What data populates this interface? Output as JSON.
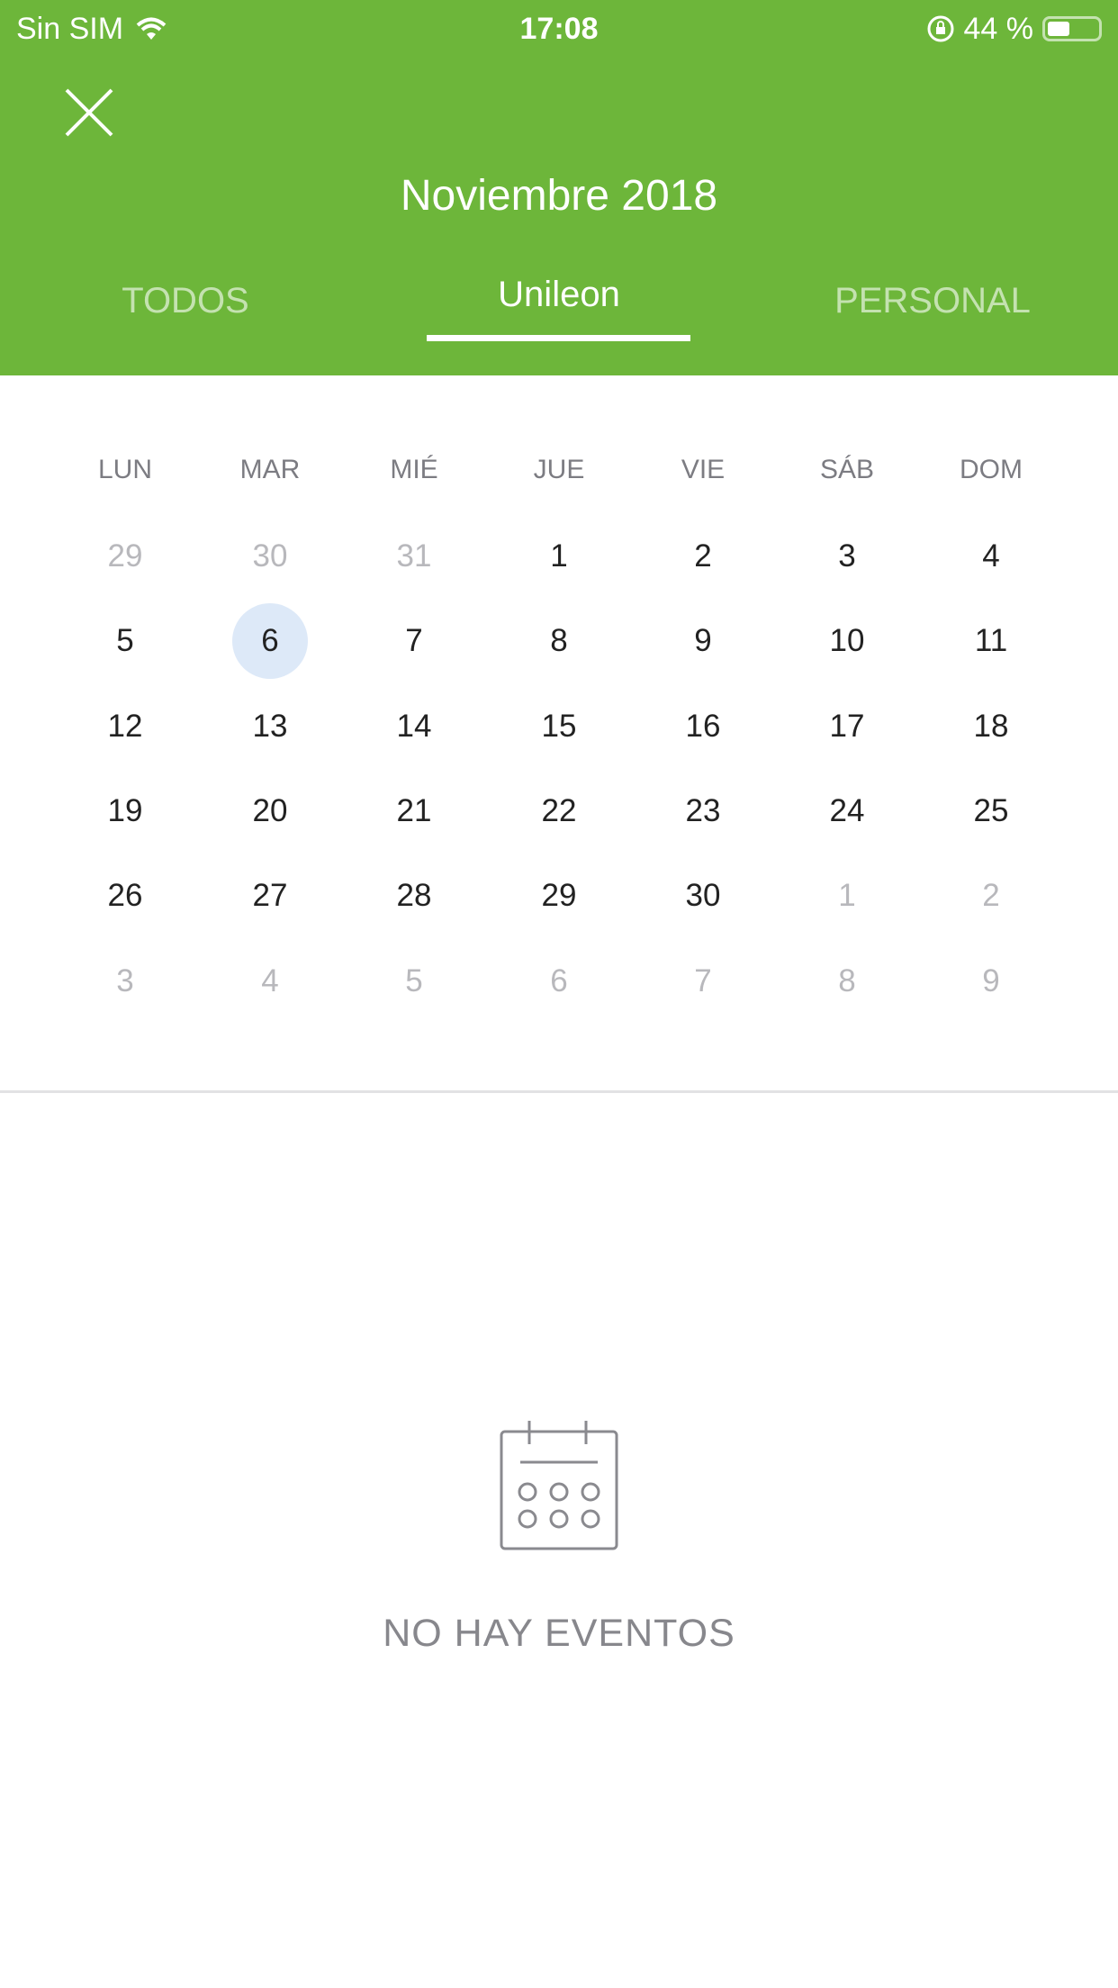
{
  "status_bar": {
    "carrier": "Sin SIM",
    "time": "17:08",
    "battery": "44 %",
    "battery_level": 0.44
  },
  "header": {
    "title": "Noviembre 2018",
    "close_icon": "close-icon",
    "tabs": [
      {
        "label": "TODOS",
        "active": false
      },
      {
        "label": "Unileon",
        "active": true
      },
      {
        "label": "PERSONAL",
        "active": false
      }
    ]
  },
  "colors": {
    "brand": "#6db63a",
    "selected_day": "#dde9f8"
  },
  "calendar": {
    "weekdays": [
      "LUN",
      "MAR",
      "MIÉ",
      "JUE",
      "VIE",
      "SÁB",
      "DOM"
    ],
    "weeks": [
      [
        {
          "d": "29",
          "out": true
        },
        {
          "d": "30",
          "out": true
        },
        {
          "d": "31",
          "out": true
        },
        {
          "d": "1"
        },
        {
          "d": "2"
        },
        {
          "d": "3"
        },
        {
          "d": "4"
        }
      ],
      [
        {
          "d": "5"
        },
        {
          "d": "6",
          "selected": true
        },
        {
          "d": "7"
        },
        {
          "d": "8"
        },
        {
          "d": "9"
        },
        {
          "d": "10"
        },
        {
          "d": "11"
        }
      ],
      [
        {
          "d": "12"
        },
        {
          "d": "13"
        },
        {
          "d": "14"
        },
        {
          "d": "15"
        },
        {
          "d": "16"
        },
        {
          "d": "17"
        },
        {
          "d": "18"
        }
      ],
      [
        {
          "d": "19"
        },
        {
          "d": "20"
        },
        {
          "d": "21"
        },
        {
          "d": "22"
        },
        {
          "d": "23"
        },
        {
          "d": "24"
        },
        {
          "d": "25"
        }
      ],
      [
        {
          "d": "26"
        },
        {
          "d": "27"
        },
        {
          "d": "28"
        },
        {
          "d": "29"
        },
        {
          "d": "30"
        },
        {
          "d": "1",
          "out": true
        },
        {
          "d": "2",
          "out": true
        }
      ],
      [
        {
          "d": "3",
          "out": true
        },
        {
          "d": "4",
          "out": true
        },
        {
          "d": "5",
          "out": true
        },
        {
          "d": "6",
          "out": true
        },
        {
          "d": "7",
          "out": true
        },
        {
          "d": "8",
          "out": true
        },
        {
          "d": "9",
          "out": true
        }
      ]
    ]
  },
  "empty_state": {
    "icon": "calendar-icon",
    "text": "NO HAY EVENTOS"
  }
}
